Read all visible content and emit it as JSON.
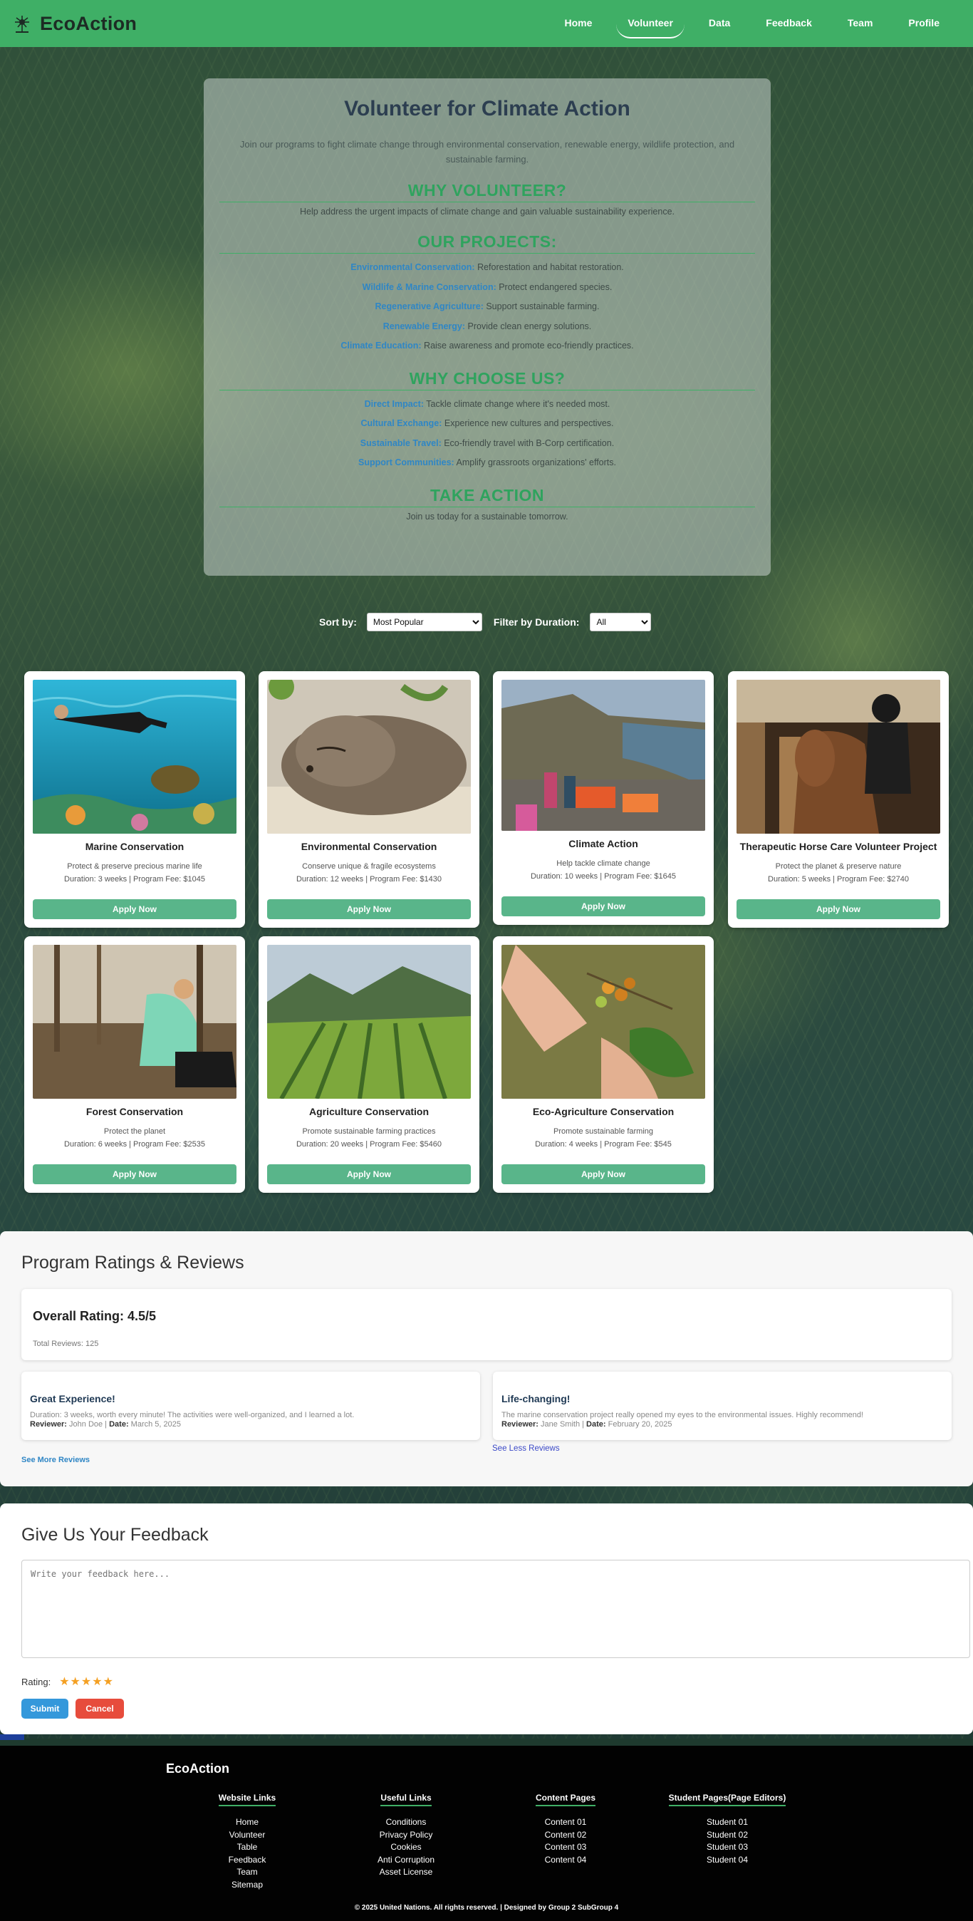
{
  "brand": {
    "name": "EcoAction"
  },
  "nav": [
    {
      "label": "Home",
      "active": false
    },
    {
      "label": "Volunteer",
      "active": true
    },
    {
      "label": "Data",
      "active": false
    },
    {
      "label": "Feedback",
      "active": false
    },
    {
      "label": "Team",
      "active": false
    },
    {
      "label": "Profile",
      "active": false
    }
  ],
  "intro": {
    "title": "Volunteer for Climate Action",
    "lead": "Join our programs to fight climate change through environmental conservation, renewable energy, wildlife protection, and sustainable farming.",
    "why_heading": "WHY VOLUNTEER?",
    "why_text": "Help address the urgent impacts of climate change and gain valuable sustainability experience.",
    "projects_heading": "OUR PROJECTS:",
    "projects": [
      {
        "name": "Environmental Conservation:",
        "text": " Reforestation and habitat restoration."
      },
      {
        "name": "Wildlife & Marine Conservation:",
        "text": " Protect endangered species."
      },
      {
        "name": "Regenerative Agriculture:",
        "text": " Support sustainable farming."
      },
      {
        "name": "Renewable Energy:",
        "text": " Provide clean energy solutions."
      },
      {
        "name": "Climate Education:",
        "text": " Raise awareness and promote eco-friendly practices."
      }
    ],
    "choose_heading": "WHY CHOOSE US?",
    "choose": [
      {
        "name": "Direct Impact:",
        "text": " Tackle climate change where it's needed most."
      },
      {
        "name": "Cultural Exchange:",
        "text": " Experience new cultures and perspectives."
      },
      {
        "name": "Sustainable Travel:",
        "text": " Eco-friendly travel with B-Corp certification."
      },
      {
        "name": "Support Communities:",
        "text": " Amplify grassroots organizations' efforts."
      }
    ],
    "action_heading": "TAKE ACTION",
    "action_text": "Join us today for a sustainable tomorrow."
  },
  "sort": {
    "sort_label": "Sort by:",
    "sort_value": "Most Popular",
    "filter_label": "Filter by Duration:",
    "filter_value": "All"
  },
  "programs": [
    {
      "title": "Marine Conservation",
      "desc": "Protect & preserve precious marine life",
      "meta": "Duration: 3 weeks | Program Fee: $1045",
      "button": "Apply Now"
    },
    {
      "title": "Environmental Conservation",
      "desc": "Conserve unique & fragile ecosystems",
      "meta": "Duration: 12 weeks | Program Fee: $1430",
      "button": "Apply Now"
    },
    {
      "title": "Climate Action",
      "desc": "Help tackle climate change",
      "meta": "Duration: 10 weeks | Program Fee: $1645",
      "button": "Apply Now"
    },
    {
      "title": "Therapeutic Horse Care Volunteer Project",
      "desc": "Protect the planet & preserve nature",
      "meta": "Duration: 5 weeks | Program Fee: $2740",
      "button": "Apply Now"
    },
    {
      "title": "Forest Conservation",
      "desc": "Protect the planet",
      "meta": "Duration: 6 weeks | Program Fee: $2535",
      "button": "Apply Now"
    },
    {
      "title": "Agriculture Conservation",
      "desc": "Promote sustainable farming practices",
      "meta": "Duration: 20 weeks | Program Fee: $5460",
      "button": "Apply Now"
    },
    {
      "title": "Eco-Agriculture Conservation",
      "desc": "Promote sustainable farming",
      "meta": "Duration: 4 weeks | Program Fee: $545",
      "button": "Apply Now"
    }
  ],
  "ratings": {
    "heading": "Program Ratings & Reviews",
    "overall": "Overall Rating: 4.5/5",
    "total": "Total Reviews: 125",
    "reviews": [
      {
        "title": "Great Experience!",
        "text": "Duration: 3 weeks, worth every minute! The activities were well-organized, and I learned a lot.",
        "reviewer_label": "Reviewer:",
        "reviewer": " John Doe | ",
        "date_label": "Date:",
        "date": " March 5, 2025"
      },
      {
        "title": "Life-changing!",
        "text": "The marine conservation project really opened my eyes to the environmental issues. Highly recommend!",
        "reviewer_label": "Reviewer:",
        "reviewer": " Jane Smith | ",
        "date_label": "Date:",
        "date": " February 20, 2025"
      }
    ],
    "see_more": "See More Reviews",
    "see_less": "See Less Reviews"
  },
  "feedback": {
    "heading": "Give Us Your Feedback",
    "placeholder": "Write your feedback here...",
    "rating_label": "Rating:",
    "stars": "★★★★★",
    "submit": "Submit",
    "cancel": "Cancel"
  },
  "footer": {
    "brand": "EcoAction",
    "columns": [
      {
        "heading": "Website Links",
        "links": [
          "Home",
          "Volunteer",
          "Table",
          "Feedback",
          "Team",
          "Sitemap"
        ]
      },
      {
        "heading": "Useful Links",
        "links": [
          "Conditions",
          "Privacy Policy",
          "Cookies",
          "Anti Corruption",
          "Asset License"
        ]
      },
      {
        "heading": "Content Pages",
        "links": [
          "Content 01",
          "Content 02",
          "Content 03",
          "Content 04"
        ]
      },
      {
        "heading": "Student Pages(Page Editors)",
        "links": [
          "Student 01",
          "Student 02",
          "Student 03",
          "Student 04"
        ]
      }
    ],
    "copyright": "© 2025 United Nations. All rights reserved. | Designed by Group 2 SubGroup 4"
  },
  "colors": {
    "header": "#3faf66",
    "accent_green": "#2fa35e",
    "apply_button": "#59b58a",
    "link_blue": "#2f86c5",
    "submit": "#3498db",
    "cancel": "#e74c3c",
    "star": "#f4a023"
  }
}
